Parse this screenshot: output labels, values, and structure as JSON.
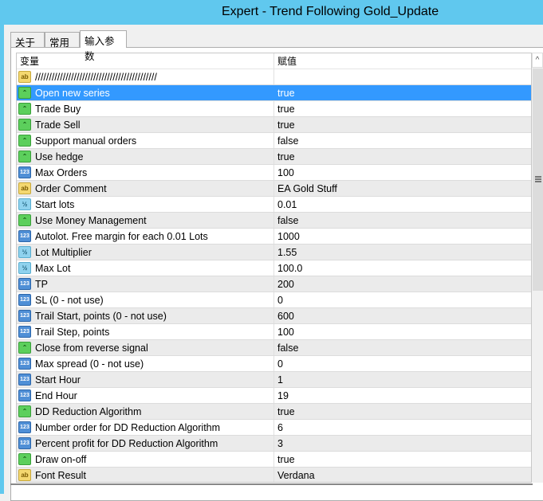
{
  "window": {
    "title": "Expert - Trend Following Gold_Update"
  },
  "tabs": [
    {
      "label": "关于"
    },
    {
      "label": "常用"
    },
    {
      "label": "输入参数",
      "active": true
    }
  ],
  "table": {
    "headers": {
      "variable": "变量",
      "value": "赋值"
    },
    "rows": [
      {
        "type": "ab",
        "name": "////////////////////////////////////////////",
        "value": ""
      },
      {
        "type": "bool",
        "name": "Open new series",
        "value": "true",
        "selected": true
      },
      {
        "type": "bool",
        "name": "Trade Buy",
        "value": "true"
      },
      {
        "type": "bool",
        "name": "Trade Sell",
        "value": "true"
      },
      {
        "type": "bool",
        "name": "Support manual orders",
        "value": "false"
      },
      {
        "type": "bool",
        "name": "Use hedge",
        "value": "true"
      },
      {
        "type": "int",
        "name": "Max Orders",
        "value": "100"
      },
      {
        "type": "ab",
        "name": "Order Comment",
        "value": "EA Gold Stuff"
      },
      {
        "type": "dbl",
        "name": "Start lots",
        "value": "0.01"
      },
      {
        "type": "bool",
        "name": "Use Money Management",
        "value": "false"
      },
      {
        "type": "int",
        "name": "Autolot. Free margin for each 0.01 Lots",
        "value": "1000"
      },
      {
        "type": "dbl",
        "name": "Lot Multiplier",
        "value": "1.55"
      },
      {
        "type": "dbl",
        "name": "Max Lot",
        "value": "100.0"
      },
      {
        "type": "int",
        "name": "TP",
        "value": "200"
      },
      {
        "type": "int",
        "name": "SL (0 - not use)",
        "value": "0"
      },
      {
        "type": "int",
        "name": "Trail Start, points (0 - not use)",
        "value": "600"
      },
      {
        "type": "int",
        "name": "Trail Step, points",
        "value": "100"
      },
      {
        "type": "bool",
        "name": "Close from reverse signal",
        "value": "false"
      },
      {
        "type": "int",
        "name": "Max spread (0 - not use)",
        "value": "0"
      },
      {
        "type": "int",
        "name": "Start Hour",
        "value": "1"
      },
      {
        "type": "int",
        "name": "End Hour",
        "value": "19"
      },
      {
        "type": "bool",
        "name": "DD Reduction Algorithm",
        "value": "true"
      },
      {
        "type": "int",
        "name": "Number order for DD Reduction Algorithm",
        "value": "6"
      },
      {
        "type": "int",
        "name": "Percent profit for DD Reduction Algorithm",
        "value": "3"
      },
      {
        "type": "bool",
        "name": "Draw on-off",
        "value": "true"
      },
      {
        "type": "ab",
        "name": "Font Result",
        "value": "Verdana"
      }
    ]
  },
  "icons": {
    "ab": "ab",
    "bool": "⌃",
    "int": "123",
    "dbl": "½"
  },
  "colors": {
    "titlebar": "#60c8ee",
    "selection": "#3399ff"
  }
}
